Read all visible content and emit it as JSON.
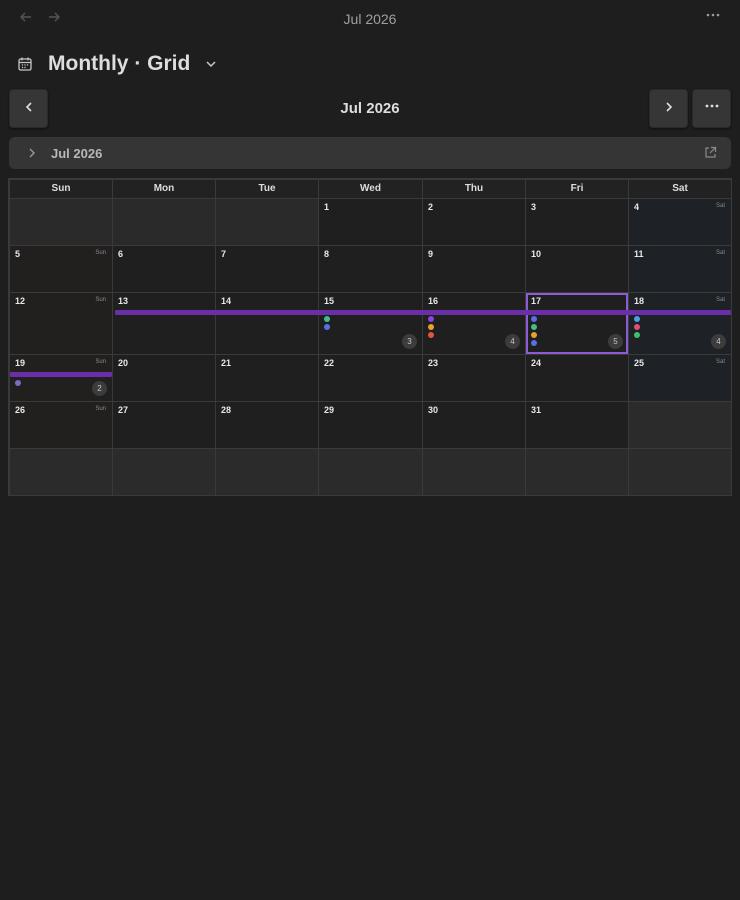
{
  "tab": {
    "title": "Jul 2026"
  },
  "view": {
    "title": "Monthly · Grid"
  },
  "nav": {
    "month_label": "Jul 2026"
  },
  "section": {
    "label": "Jul 2026"
  },
  "weekdays": [
    "Sun",
    "Mon",
    "Tue",
    "Wed",
    "Thu",
    "Fri",
    "Sat"
  ],
  "weekend_tags": {
    "sun": "Sun",
    "sat": "Sat"
  },
  "days": [
    {
      "n": "1"
    },
    {
      "n": "2"
    },
    {
      "n": "3"
    },
    {
      "n": "4",
      "tag": "Sat"
    },
    {
      "n": "5",
      "tag": "Sun"
    },
    {
      "n": "6"
    },
    {
      "n": "7"
    },
    {
      "n": "8"
    },
    {
      "n": "9"
    },
    {
      "n": "10"
    },
    {
      "n": "11",
      "tag": "Sat"
    },
    {
      "n": "12",
      "tag": "Sun"
    },
    {
      "n": "13"
    },
    {
      "n": "14"
    },
    {
      "n": "15",
      "count": "3",
      "dots": [
        "#3fbf8c",
        "#5b6ee8"
      ]
    },
    {
      "n": "16",
      "count": "4",
      "dots": [
        "#8b45d8",
        "#e8a030",
        "#e0553c"
      ]
    },
    {
      "n": "17",
      "count": "5",
      "today": true,
      "dots": [
        "#5b6ee8",
        "#3fbf8c",
        "#e8a030",
        "#5b6ee8"
      ]
    },
    {
      "n": "18",
      "tag": "Sat",
      "count": "4",
      "dots": [
        "#4aa0e0",
        "#e04f78",
        "#3fbf6a"
      ]
    },
    {
      "n": "19",
      "tag": "Sun",
      "count": "2",
      "dots": [
        "#7a6bc8"
      ]
    },
    {
      "n": "20"
    },
    {
      "n": "21"
    },
    {
      "n": "22"
    },
    {
      "n": "23"
    },
    {
      "n": "24"
    },
    {
      "n": "25",
      "tag": "Sat"
    },
    {
      "n": "26",
      "tag": "Sun"
    },
    {
      "n": "27"
    },
    {
      "n": "28"
    },
    {
      "n": "29"
    },
    {
      "n": "30"
    },
    {
      "n": "31"
    }
  ],
  "colors": {
    "accent": "#8b5cd6",
    "event_bar": "#6a2fa8"
  },
  "icons": [
    "arrow-left-icon",
    "arrow-right-icon",
    "more-icon",
    "calendar-icon",
    "chevron-down-icon",
    "chevron-left-icon",
    "chevron-right-icon",
    "chevron-expand-icon",
    "external-link-icon"
  ]
}
